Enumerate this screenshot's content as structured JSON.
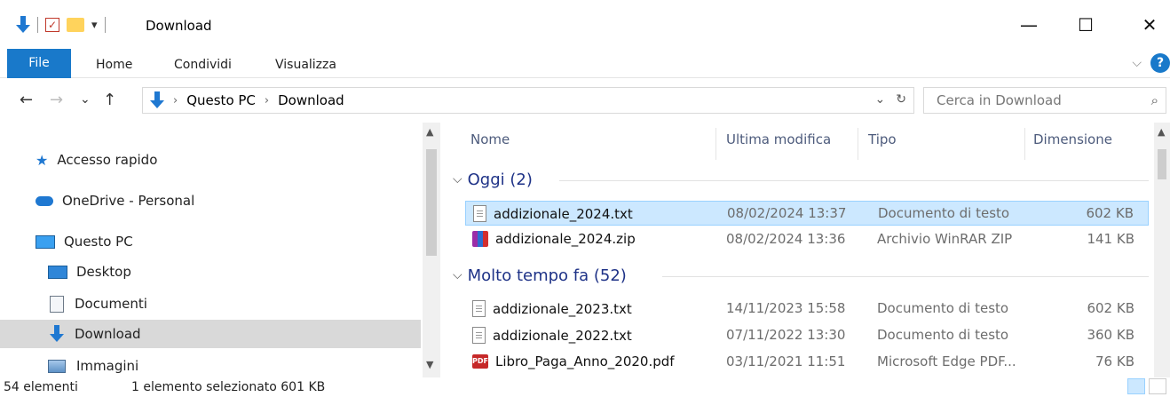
{
  "window": {
    "title": "Download",
    "minimize": "—",
    "maximize": "☐",
    "close": "✕"
  },
  "quick_access": {
    "dropdown": "▾"
  },
  "ribbon": {
    "tabs": [
      "File",
      "Home",
      "Condividi",
      "Visualizza"
    ],
    "expand": "⌵",
    "help": "?"
  },
  "address": {
    "back": "←",
    "forward": "→",
    "recent": "⌄",
    "up": "↑",
    "sep": "›",
    "crumbs": [
      "Questo PC",
      "Download"
    ],
    "dropdown": "⌄",
    "refresh": "↻"
  },
  "search": {
    "placeholder": "Cerca in Download",
    "icon": "⌕"
  },
  "nav_pane": {
    "items": [
      {
        "label": "Accesso rapido",
        "icon": "star-icon"
      },
      {
        "label": "OneDrive - Personal",
        "icon": "cloud-icon"
      },
      {
        "label": "Questo PC",
        "icon": "pc-icon"
      },
      {
        "label": "Desktop",
        "icon": "desktop-icon"
      },
      {
        "label": "Documenti",
        "icon": "documents-icon"
      },
      {
        "label": "Download",
        "icon": "download-icon",
        "selected": true
      },
      {
        "label": "Immagini",
        "icon": "pictures-icon"
      }
    ],
    "scroll_up": "▲",
    "scroll_down": "▼"
  },
  "columns": {
    "name": "Nome",
    "modified": "Ultima modifica",
    "type": "Tipo",
    "size": "Dimensione"
  },
  "groups": [
    {
      "label": "Oggi (2)",
      "files": [
        {
          "name": "addizionale_2024.txt",
          "modified": "08/02/2024 13:37",
          "type": "Documento di testo",
          "size": "602 KB",
          "icon": "txt-file-icon",
          "selected": true
        },
        {
          "name": "addizionale_2024.zip",
          "modified": "08/02/2024 13:36",
          "type": "Archivio WinRAR ZIP",
          "size": "141 KB",
          "icon": "zip-file-icon"
        }
      ]
    },
    {
      "label": "Molto tempo fa (52)",
      "files": [
        {
          "name": "addizionale_2023.txt",
          "modified": "14/11/2023 15:58",
          "type": "Documento di testo",
          "size": "602 KB",
          "icon": "txt-file-icon"
        },
        {
          "name": "addizionale_2022.txt",
          "modified": "07/11/2022 13:30",
          "type": "Documento di testo",
          "size": "360 KB",
          "icon": "txt-file-icon"
        },
        {
          "name": "Libro_Paga_Anno_2020.pdf",
          "modified": "03/11/2021 11:51",
          "type": "Microsoft Edge PDF...",
          "size": "76 KB",
          "icon": "pdf-file-icon"
        }
      ]
    }
  ],
  "group_chevron": "⌵",
  "status": {
    "count": "54 elementi",
    "selection": "1 elemento selezionato  601 KB"
  }
}
